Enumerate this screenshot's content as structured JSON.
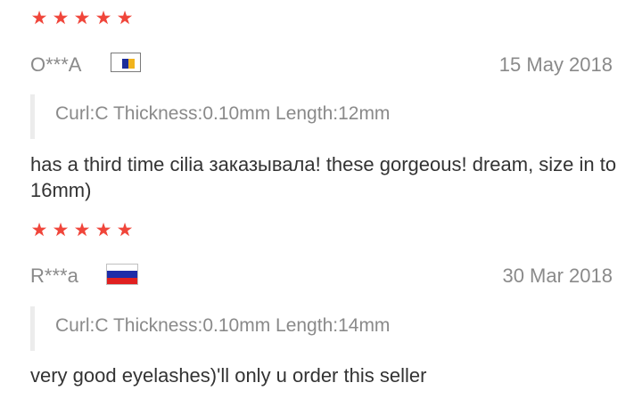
{
  "reviews": [
    {
      "rating": 5,
      "user": "O***A",
      "flag_icon": "flag-icon-generic",
      "date": "15 May 2018",
      "attributes": "Curl:C Thickness:0.10mm Length:12mm",
      "text": "has a third time cilia заказывала! these gorgeous! dream, size in to 16mm)"
    },
    {
      "rating": 5,
      "user": "R***a",
      "flag_icon": "flag-icon-russia",
      "date": "30 Mar 2018",
      "attributes": "Curl:C Thickness:0.10mm Length:14mm",
      "text": "very good eyelashes)'ll only u order this seller"
    }
  ],
  "colors": {
    "star": "#f0453a",
    "muted": "#8a8a8a",
    "text": "#333333"
  }
}
